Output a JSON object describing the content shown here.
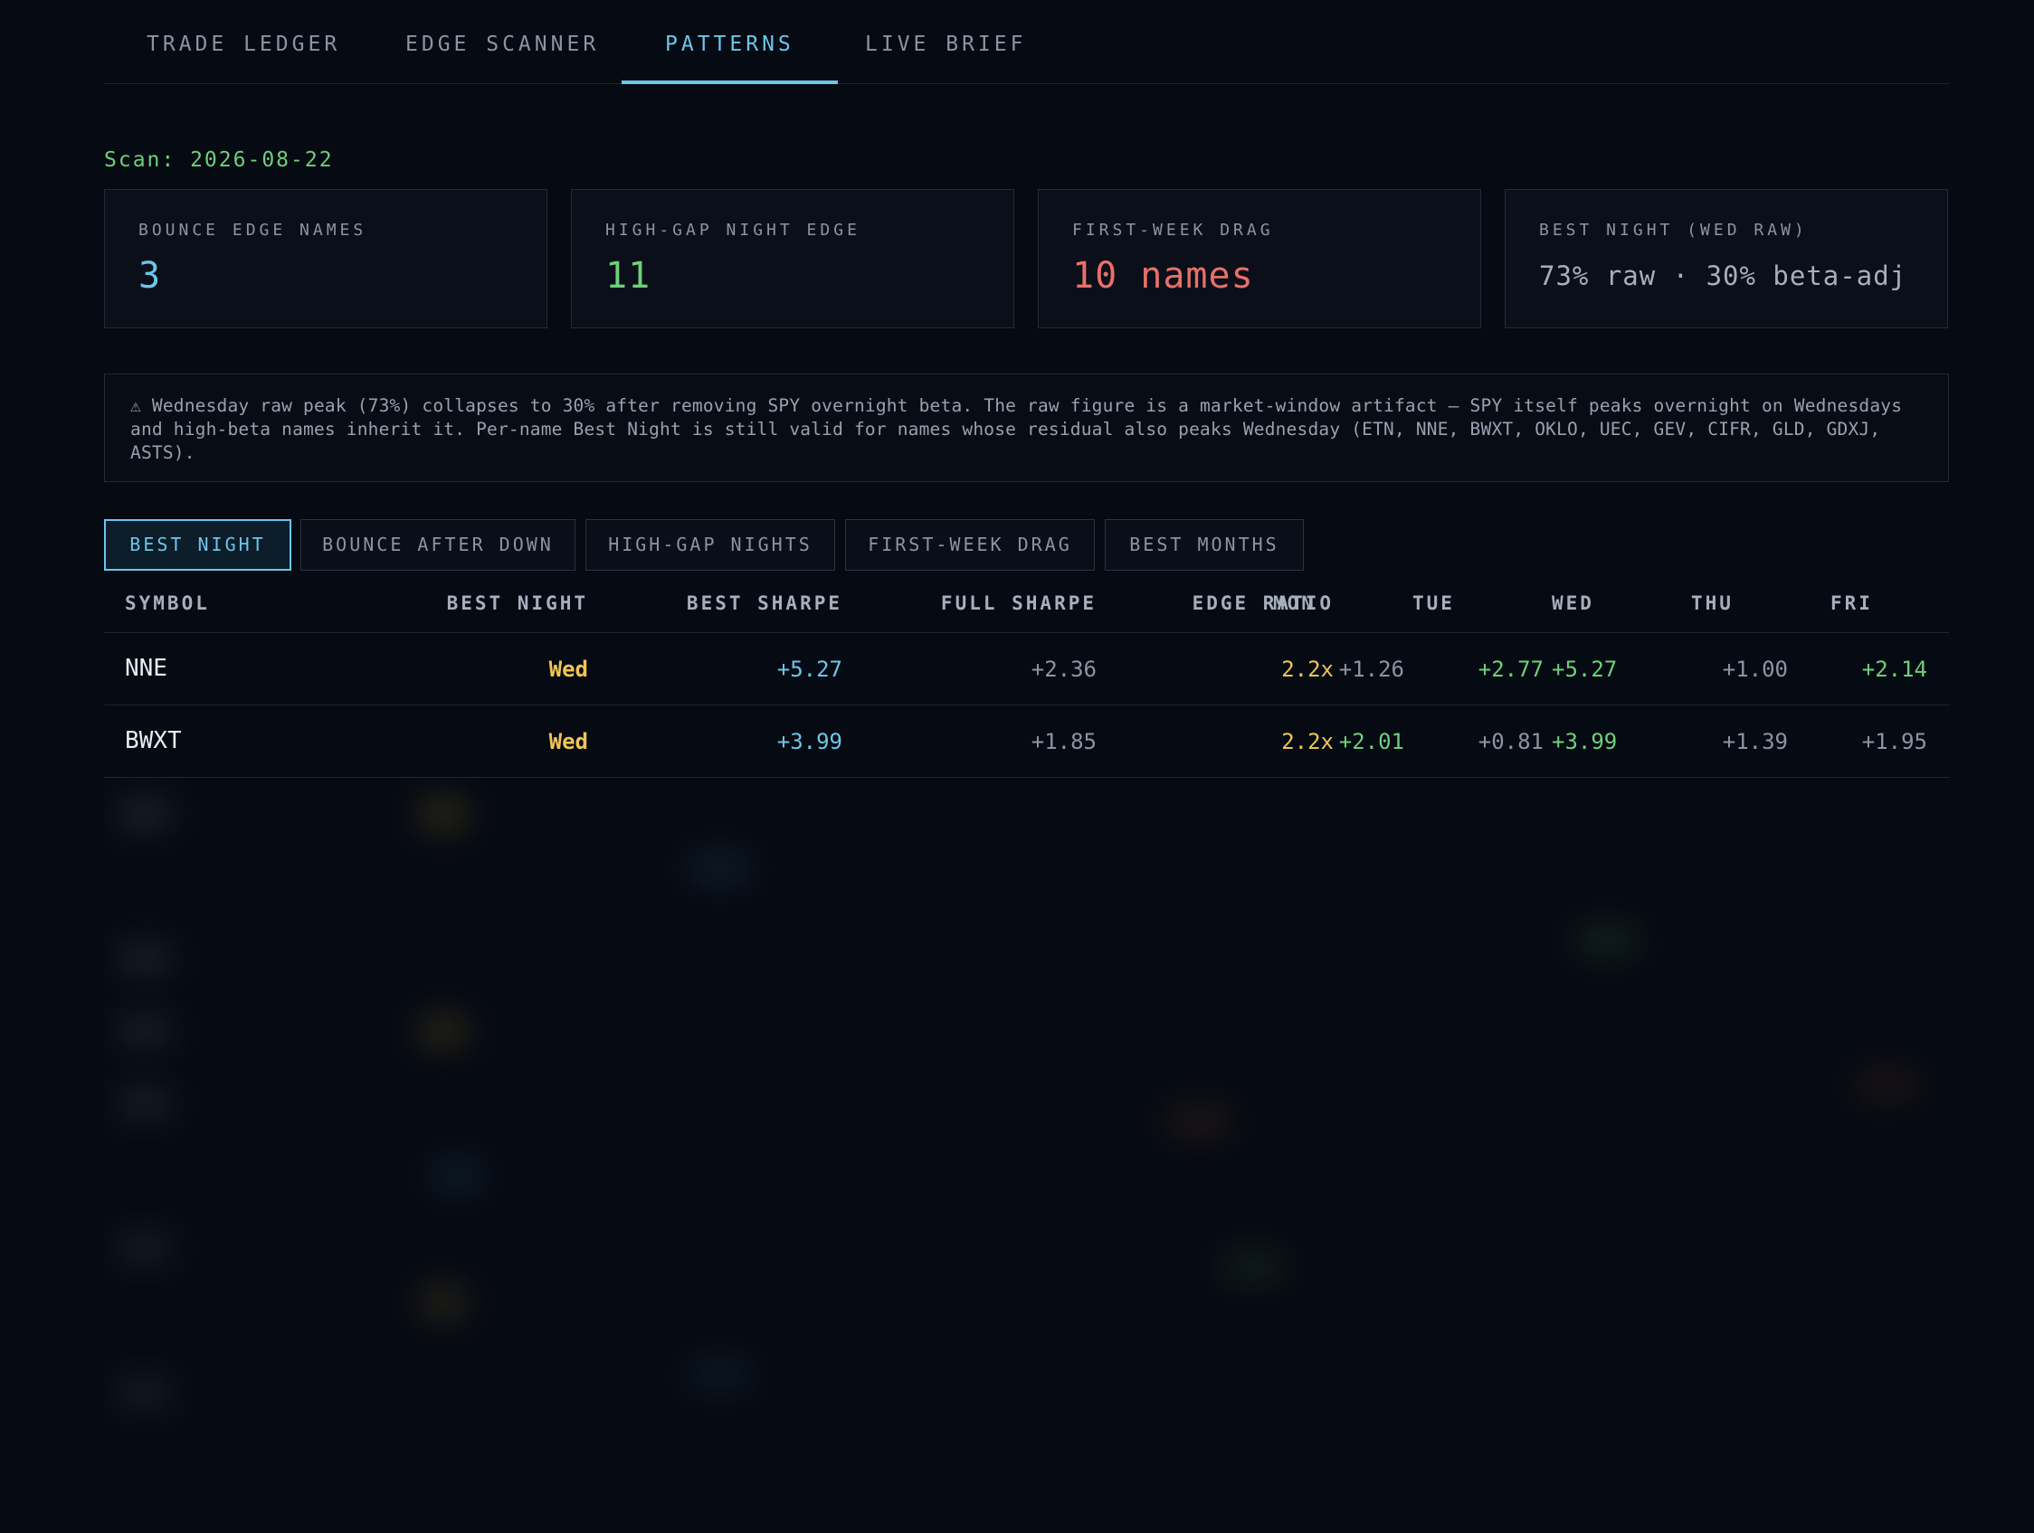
{
  "nav": {
    "tabs": [
      {
        "label": "TRADE LEDGER",
        "active": false
      },
      {
        "label": "EDGE SCANNER",
        "active": false
      },
      {
        "label": "PATTERNS",
        "active": true
      },
      {
        "label": "LIVE BRIEF",
        "active": false
      }
    ]
  },
  "scan": {
    "label": "Scan: 2026-08-22"
  },
  "cards": [
    {
      "label": "BOUNCE EDGE NAMES",
      "value": "3",
      "color": "#6cc6ea"
    },
    {
      "label": "HIGH-GAP NIGHT EDGE",
      "value": "11",
      "color": "#6ed07a"
    },
    {
      "label": "FIRST-WEEK DRAG",
      "value": "10 names",
      "color": "#e8706a"
    },
    {
      "label": "BEST NIGHT (WED RAW)",
      "value": "73% raw · 30% beta-adj",
      "color": "#a6afbd"
    }
  ],
  "banner": {
    "text": "⚠ Wednesday raw peak (73%) collapses to 30% after removing SPY overnight beta. The raw figure is a market-window artifact — SPY itself peaks overnight on Wednesdays and high-beta names inherit it. Per-name Best Night is still valid for names whose residual also peaks Wednesday (ETN, NNE, BWXT, OKLO, UEC, GEV, CIFR, GLD, GDXJ, ASTS)."
  },
  "subtabs": [
    {
      "label": "BEST NIGHT",
      "active": true
    },
    {
      "label": "BOUNCE AFTER DOWN",
      "active": false
    },
    {
      "label": "HIGH-GAP NIGHTS",
      "active": false
    },
    {
      "label": "FIRST-WEEK DRAG",
      "active": false
    },
    {
      "label": "BEST MONTHS",
      "active": false
    }
  ],
  "table": {
    "headers": [
      "SYMBOL",
      "BEST NIGHT",
      "BEST SHARPE",
      "FULL SHARPE",
      "EDGE RATIO",
      "MON",
      "TUE",
      "WED",
      "THU",
      "FRI"
    ],
    "rows": [
      {
        "symbol": "NNE",
        "best_night": "Wed",
        "best_sharpe": "+5.27",
        "full_sharpe": "+2.36",
        "edge_ratio": "2.2x",
        "mon": "+1.26",
        "tue": "+2.77",
        "wed": "+5.27",
        "thu": "+1.00",
        "fri": "+2.14"
      },
      {
        "symbol": "BWXT",
        "best_night": "Wed",
        "best_sharpe": "+3.99",
        "full_sharpe": "+1.85",
        "edge_ratio": "2.2x",
        "mon": "+2.01",
        "tue": "+0.81",
        "wed": "+3.99",
        "thu": "+1.39",
        "fri": "+1.95"
      }
    ]
  },
  "colors": {
    "accent": "#6cc6ea",
    "positive": "#6ed07a",
    "negative": "#e8706a",
    "highlight": "#f1c453",
    "muted": "#8b94a3"
  }
}
